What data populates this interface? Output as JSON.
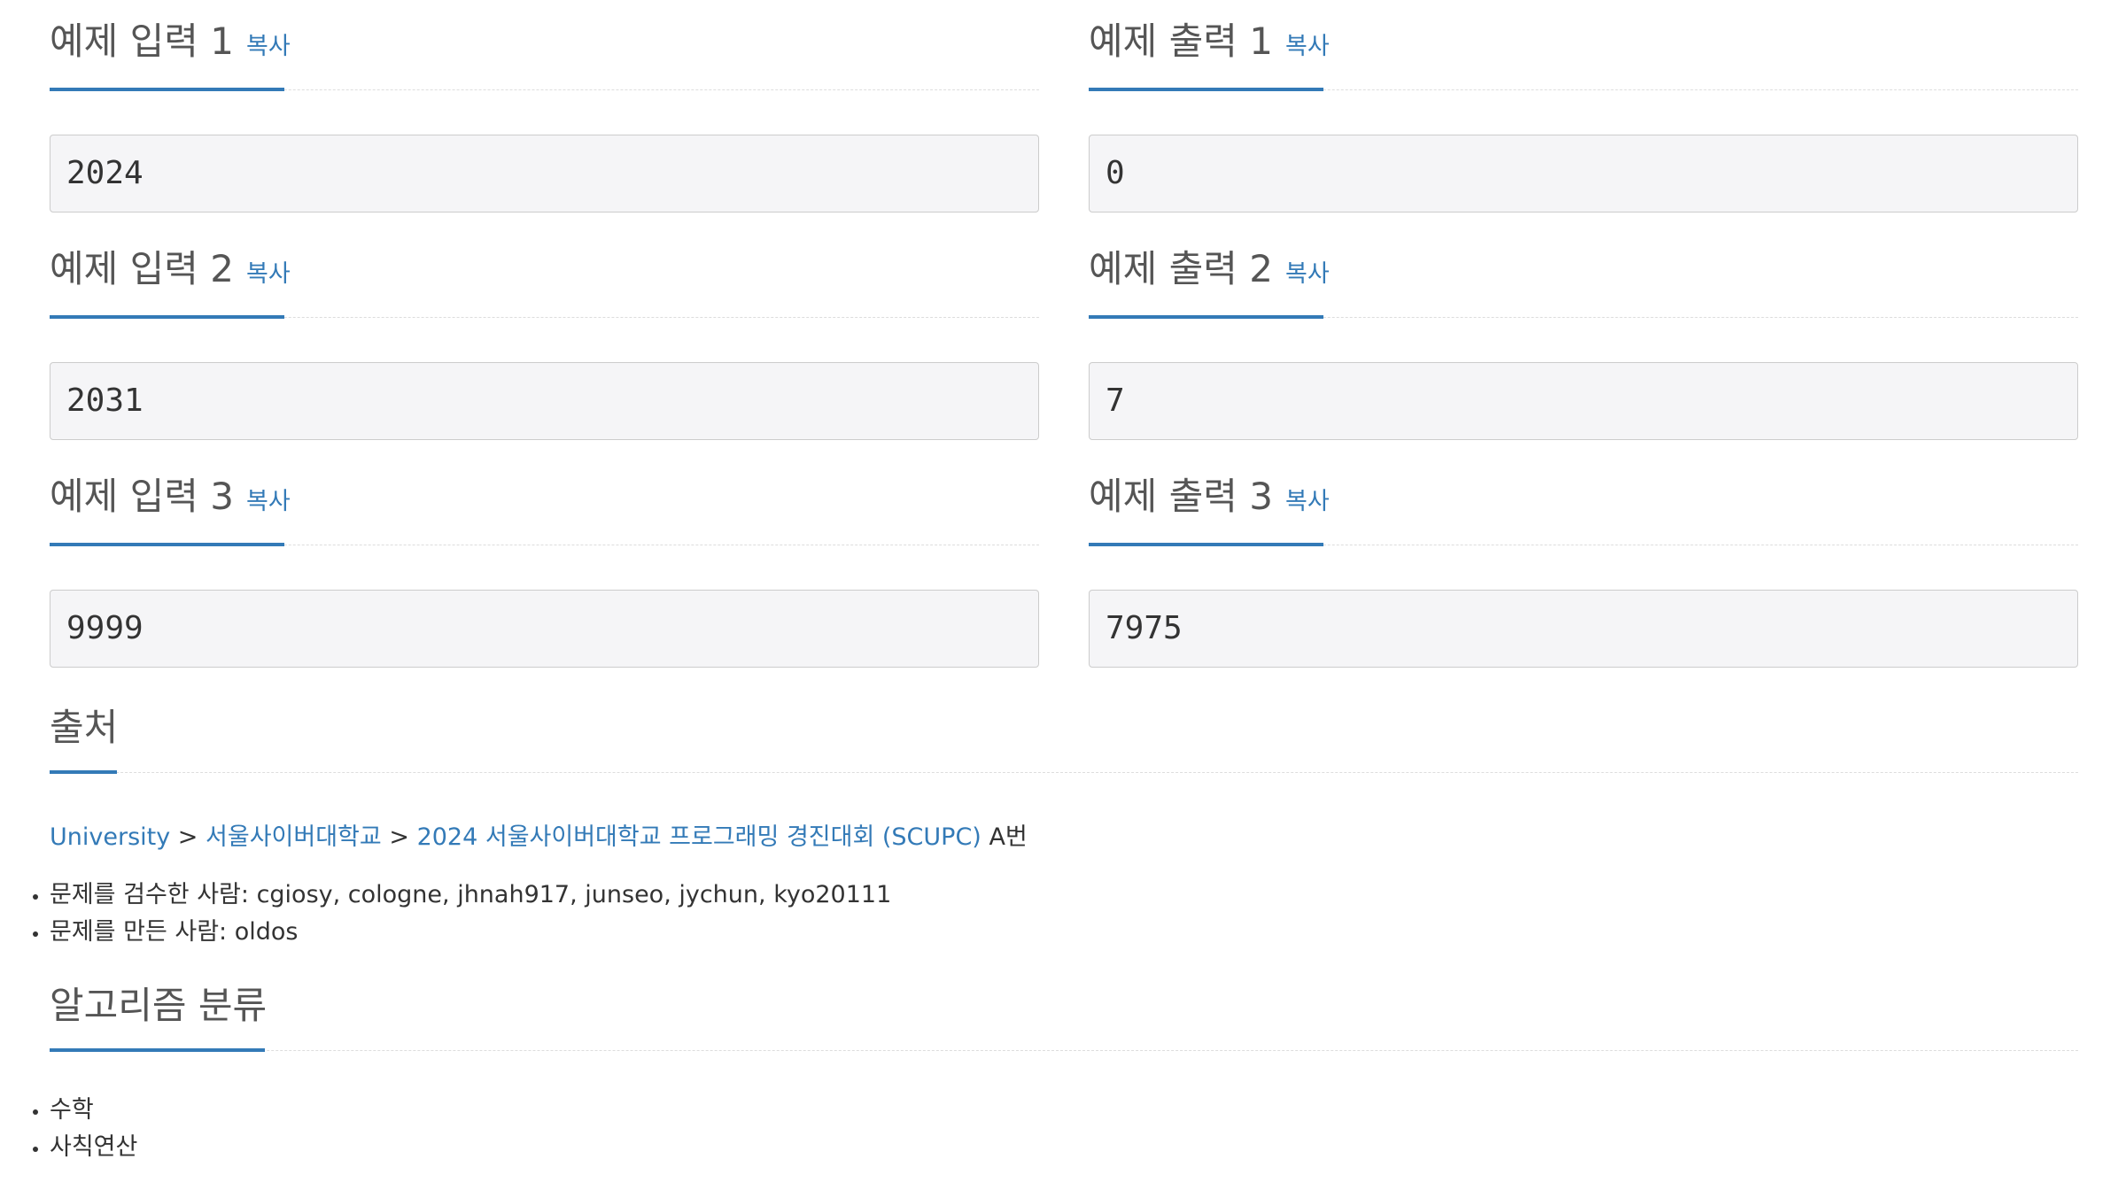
{
  "samples": [
    {
      "title": "예제 입력 1",
      "copy": "복사",
      "value": "2024"
    },
    {
      "title": "예제 출력 1",
      "copy": "복사",
      "value": "0"
    },
    {
      "title": "예제 입력 2",
      "copy": "복사",
      "value": "2031"
    },
    {
      "title": "예제 출력 2",
      "copy": "복사",
      "value": "7"
    },
    {
      "title": "예제 입력 3",
      "copy": "복사",
      "value": "9999"
    },
    {
      "title": "예제 출력 3",
      "copy": "복사",
      "value": "7975"
    }
  ],
  "source": {
    "title": "출처",
    "breadcrumb": [
      {
        "label": "University"
      },
      {
        "label": "서울사이버대학교"
      },
      {
        "label": "2024 서울사이버대학교 프로그래밍 경진대회 (SCUPC)"
      }
    ],
    "separator": ">",
    "problem_suffix": "A번",
    "credits": [
      "문제를 검수한 사람: cgiosy, cologne, jhnah917, junseo, jychun, kyo20111",
      "문제를 만든 사람: oldos"
    ]
  },
  "algorithm": {
    "title": "알고리즘 분류",
    "tags": [
      "수학",
      "사칙연산"
    ]
  },
  "colors": {
    "accent": "#337ab7",
    "heading": "#555555",
    "sample_bg": "#f5f5f7",
    "sample_border": "#cccccc"
  }
}
